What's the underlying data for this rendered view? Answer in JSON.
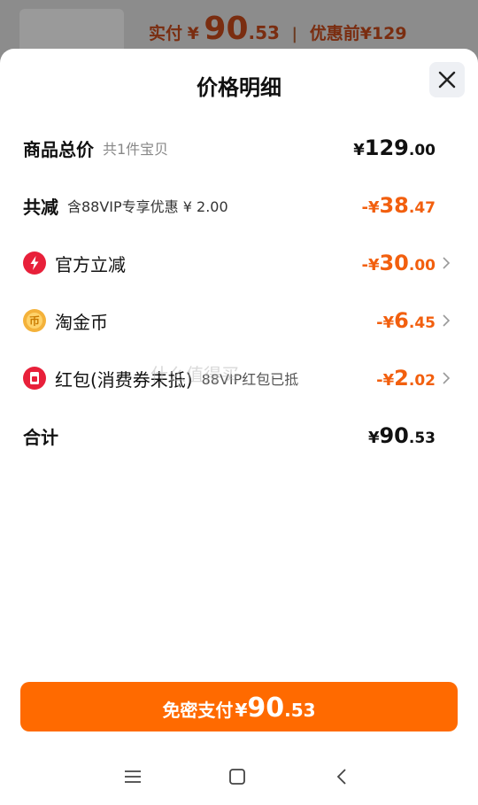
{
  "background": {
    "pay_label": "实付",
    "currency": "¥",
    "pay_int": "90",
    "pay_dec": ".53",
    "separator": "|",
    "before_label": "优惠前",
    "before_amount": "¥129"
  },
  "sheet": {
    "title": "价格明细",
    "close_icon": "close-icon"
  },
  "rows": {
    "total": {
      "name": "商品总价",
      "sub": "共1件宝贝",
      "sym": "¥",
      "int": "129",
      "dec": ".00"
    },
    "reduce": {
      "name": "共减",
      "sub": "含88VIP专享优惠 ¥ 2.00",
      "sym": "-¥",
      "int": "38",
      "dec": ".47"
    },
    "official": {
      "name": "官方立减",
      "icon": "lightning-icon",
      "sym": "-¥",
      "int": "30",
      "dec": ".00"
    },
    "coins": {
      "name": "淘金币",
      "icon": "coin-icon",
      "sym": "-¥",
      "int": "6",
      "dec": ".45"
    },
    "redpacket": {
      "name": "红包(消费券未抵)",
      "sub": "88VIP红包已抵",
      "icon": "red-packet-icon",
      "sym": "-¥",
      "int": "2",
      "dec": ".02"
    },
    "sum": {
      "name": "合计",
      "sym": "¥",
      "int": "90",
      "dec": ".53"
    }
  },
  "watermark": "什么值得买",
  "pay_button": {
    "label": "免密支付",
    "sym": "¥",
    "int": "90",
    "dec": ".53"
  },
  "colors": {
    "accent": "#ff6a00",
    "discount": "#f25f0e",
    "icon_red": "#e8203a",
    "coin": "#f4b23a"
  },
  "navbar": {
    "menu": "menu-icon",
    "home": "home-icon",
    "back": "back-icon"
  }
}
